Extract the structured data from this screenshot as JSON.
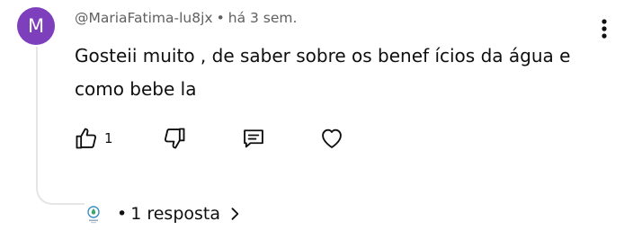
{
  "comment": {
    "avatar_letter": "M",
    "avatar_color": "#7e3fbd",
    "author": "@MariaFatima-lu8jx",
    "separator": "•",
    "time": "há 3 sem.",
    "text": "Gosteii muito , de saber sobre os benef ícios da água e como bebe la"
  },
  "actions": {
    "like_count": "1",
    "icons": [
      "thumbs-up-icon",
      "thumbs-down-icon",
      "reply-icon",
      "heart-icon"
    ]
  },
  "replies": {
    "bullet": "•",
    "label": "1 resposta"
  },
  "colors": {
    "text": "#0f0f0f",
    "secondary_text": "#606060",
    "thread_line": "#e5e5e5",
    "avatar": "#7e3fbd"
  }
}
